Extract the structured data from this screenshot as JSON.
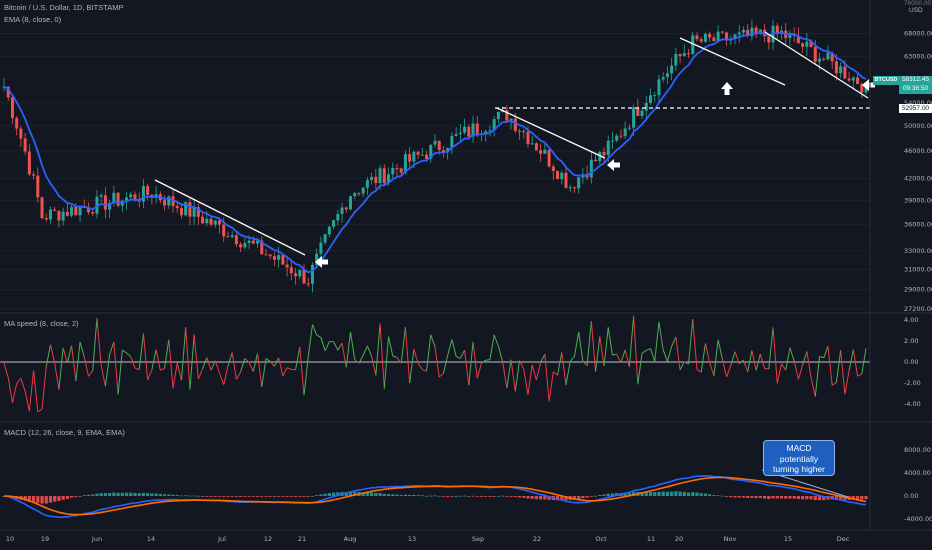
{
  "header": {
    "symbol_line": "Bitcoin / U.S. Dollar, 1D, BITSTAMP",
    "ema_label": "EMA (8, close, 0)",
    "currency": "USD",
    "top_tick": "76000.00"
  },
  "price_tags": {
    "ticker": "BTCUSD",
    "price": "58312.45",
    "countdown": "09:36:50",
    "level": "52957.00"
  },
  "callout": {
    "text": "MACD potentially turning higher"
  },
  "colors": {
    "background": "#131722",
    "up": "#26a69a",
    "down": "#ef5350",
    "ema": "#2962ff",
    "macd_line": "#2962ff",
    "signal_line": "#ff6d00",
    "speed_up": "#4caf50",
    "speed_down": "#f23645"
  },
  "chart_data": [
    {
      "type": "candlestick",
      "title": "Bitcoin / U.S. Dollar, 1D, BITSTAMP",
      "y_axis_ticks": [
        "68000.00",
        "63000.00",
        "54000.00",
        "50000.00",
        "46000.00",
        "42000.00",
        "39000.00",
        "36000.00",
        "33000.00",
        "31000.00",
        "29000.00",
        "27200.00"
      ],
      "x_axis_ticks": [
        "10",
        "19",
        "Jun",
        "14",
        "Jul",
        "12",
        "21",
        "Aug",
        "13",
        "Sep",
        "22",
        "Oct",
        "11",
        "20",
        "Nov",
        "15",
        "Dec"
      ],
      "ema_series": "EMA (8, close, 0)",
      "key_points": [
        {
          "date": "May 10",
          "price": 57000
        },
        {
          "date": "May 19",
          "price": 37000
        },
        {
          "date": "Jun 14",
          "price": 40000
        },
        {
          "date": "Jul 21",
          "price": 30000
        },
        {
          "date": "Aug",
          "price": 40000
        },
        {
          "date": "Sep 7",
          "price": 52000
        },
        {
          "date": "Sep 22",
          "price": 41000
        },
        {
          "date": "Oct",
          "price": 47000
        },
        {
          "date": "Oct 20",
          "price": 66000
        },
        {
          "date": "Nov 10",
          "price": 68000
        },
        {
          "date": "Dec",
          "price": 57000
        }
      ],
      "annotations": [
        "support level 52957.00",
        "descending trendline breakouts marked with arrows"
      ]
    },
    {
      "type": "line",
      "title": "MA speed (8, close, 2)",
      "y_axis_ticks": [
        "4.00",
        "2.00",
        "0.00",
        "-2.00",
        "-4.00"
      ],
      "ylim": [
        -5,
        5
      ]
    },
    {
      "type": "line",
      "title": "MACD (12, 26, close, 9, EMA, EMA)",
      "y_axis_ticks": [
        "8000.00",
        "4000.00",
        "0.00",
        "-4000.00"
      ],
      "series": [
        {
          "name": "MACD"
        },
        {
          "name": "Signal"
        },
        {
          "name": "Histogram"
        }
      ]
    }
  ]
}
